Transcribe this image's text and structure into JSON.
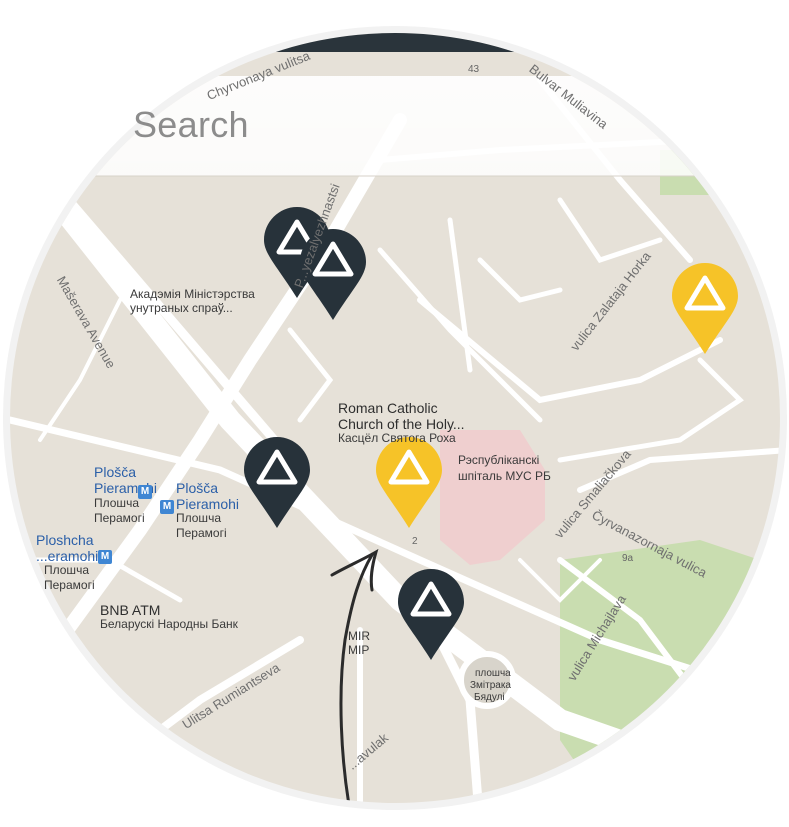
{
  "search": {
    "placeholder": "Search"
  },
  "colors": {
    "map_bg": "#e6e1d8",
    "road": "#ffffff",
    "park": "#c9ddb0",
    "hospital_area": "#efcfcf",
    "marker_dark": "#27323a",
    "marker_yellow": "#f6c328",
    "phone_frame": "#2a343b",
    "metro_blue": "#3f86d3"
  },
  "streets": {
    "chyrvonaya": "Chyrvonaya vulitsa",
    "prospekt": "P...yezalyezhnastsi",
    "bulvar": "Bulvar Muliavina",
    "masherava": "Mašerava Avenue",
    "zalataja": "vulica Zalataja Horka",
    "smaliackova": "vulica Smaliačkova",
    "cyrvanazornaja": "Čyrvanazornaja vulica",
    "michajlava": "vulica Michajlava",
    "rumiantseva": "Ulitsa Rumiantseva",
    "kavulak": "...avulak"
  },
  "places": {
    "academy": "Акадэмія Міністэрства унутраных спраў...",
    "church_line1": "Roman Catholic",
    "church_line2": "Church of the Holy...",
    "church_line3": "Касцёл Святога Роха",
    "hospital_line1": "Рэспубліканскі",
    "hospital_line2": "шпіталь МУС РБ",
    "plosca1_line1": "Plošča",
    "plosca1_line2": "Pieramohi",
    "plosca2_line1": "Plošča",
    "plosca2_line2": "Pieramohi",
    "plosca2_line3": "Плошча",
    "plosca2_line4": "Перамогі",
    "ploshcha_line1": "Ploshcha",
    "ploshcha_line2": "...eramohi",
    "ploshcha_line3": "Плошча",
    "ploshcha_line4": "Перамогі",
    "plosca1_line3": "Плошча",
    "plosca1_line4": "Перамогі",
    "bnb_line1": "BNB ATM",
    "bnb_line2": "Беларускі Народны Банк",
    "mir_line1": "MIR",
    "mir_line2": "МІР",
    "zmitraka_line1": "плошча",
    "zmitraka_line2": "Змітрака",
    "zmitraka_line3": "Бядулі",
    "num43": "43",
    "num2": "2",
    "num9a": "9a"
  },
  "markers": [
    {
      "kind": "dark",
      "icon": "mountain-icon"
    },
    {
      "kind": "dark",
      "icon": "mountain-icon"
    },
    {
      "kind": "dark",
      "icon": "mountain-icon"
    },
    {
      "kind": "dark",
      "icon": "mountain-icon"
    },
    {
      "kind": "yellow",
      "icon": "mountain-icon"
    },
    {
      "kind": "yellow",
      "icon": "mountain-icon"
    }
  ]
}
